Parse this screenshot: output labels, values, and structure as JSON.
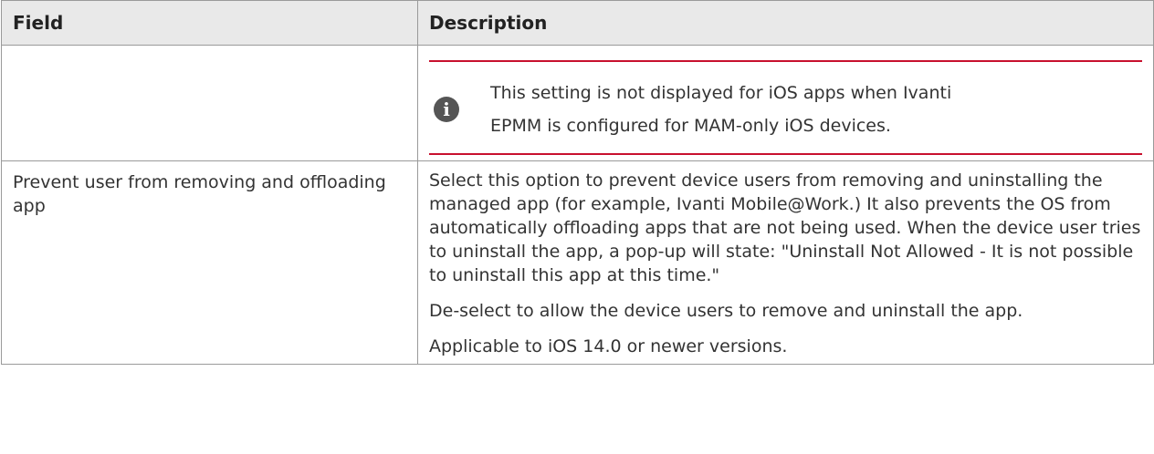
{
  "table": {
    "headers": {
      "field": "Field",
      "description": "Description"
    },
    "note": {
      "icon": "info-icon",
      "accent_color": "#c8102e",
      "text": "This setting is not displayed for iOS apps when Ivanti EPMM is configured for MAM-only iOS devices."
    },
    "rows": [
      {
        "field": "Prevent user from removing and offloading app",
        "paragraphs": [
          "Select this option to prevent device users from removing and uninstalling the managed app (for example, Ivanti Mobile@Work.) It also prevents the OS from automatically offloading apps that are not being used. When the device user tries to uninstall the app, a pop-up will state: \"Uninstall Not Allowed - It is not possible to uninstall this app at this time.\"",
          "De-select to allow the device users to remove and uninstall the app.",
          "Applicable to iOS 14.0 or newer versions."
        ]
      }
    ]
  }
}
